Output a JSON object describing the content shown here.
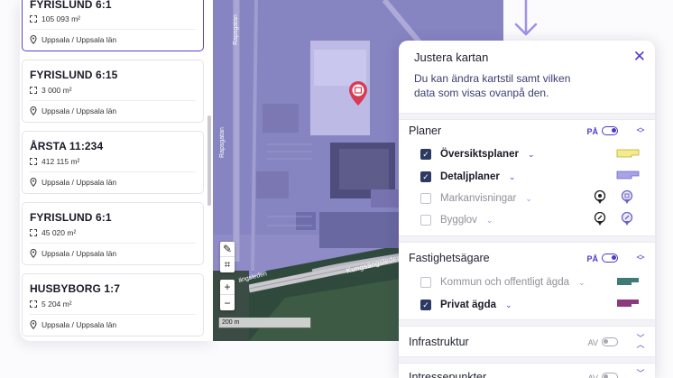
{
  "properties": [
    {
      "title": "FYRISLUND 6:1",
      "area": "105 093 m²",
      "location": "Uppsala / Uppsala län",
      "selected": true
    },
    {
      "title": "FYRISLUND 6:15",
      "area": "3 000 m²",
      "location": "Uppsala / Uppsala län",
      "selected": false
    },
    {
      "title": "ÅRSTA 11:234",
      "area": "412 115 m²",
      "location": "Uppsala / Uppsala län",
      "selected": false
    },
    {
      "title": "FYRISLUND 6:1",
      "area": "45 020 m²",
      "location": "Uppsala / Uppsala län",
      "selected": false
    },
    {
      "title": "HUSBYBORG 1:7",
      "area": "5 204 m²",
      "location": "Uppsala / Uppsala län",
      "selected": false
    }
  ],
  "map": {
    "scale_label": "200 m",
    "road_main": "Kungsängsleden",
    "road_short": "ängsleden",
    "road_vertical_1": "Rapsgatan",
    "road_vertical_2": "Rapsgatan",
    "tools": {
      "draw_icon": "pencil-icon",
      "select_icon": "square-select-icon",
      "zoom_in": "+",
      "zoom_out": "−"
    }
  },
  "panel": {
    "title": "Justera kartan",
    "description": "Du kan ändra kartstil samt vilken data som visas ovanpå den.",
    "sections": [
      {
        "title": "Planer",
        "toggle_label": "PÅ",
        "on": true,
        "items": [
          {
            "label": "Översiktsplaner",
            "checked": true,
            "legend_color": "#f6eb8a"
          },
          {
            "label": "Detaljplaner",
            "checked": true,
            "legend_color": "#a8a3e6"
          },
          {
            "label": "Markanvisningar",
            "checked": false,
            "legend_icons": [
              "marker-pin-icon",
              "marker-badge-icon"
            ]
          },
          {
            "label": "Bygglov",
            "checked": false,
            "legend_icons": [
              "hammer-pin-icon",
              "hammer-badge-icon"
            ]
          }
        ]
      },
      {
        "title": "Fastighetsägare",
        "toggle_label": "PÅ",
        "on": true,
        "items": [
          {
            "label": "Kommun och offentligt ägda",
            "checked": false,
            "legend_color": "#3f7a78"
          },
          {
            "label": "Privat ägda",
            "checked": true,
            "legend_color": "#8c3a7d"
          }
        ]
      },
      {
        "title": "Infrastruktur",
        "toggle_label": "AV",
        "on": false,
        "items": []
      },
      {
        "title": "Intressepunkter",
        "toggle_label": "AV",
        "on": false,
        "items": []
      }
    ]
  },
  "colors": {
    "accent": "#4a3acb",
    "map_tint": "#8b88c4",
    "selected_border": "#5b3fd1"
  }
}
